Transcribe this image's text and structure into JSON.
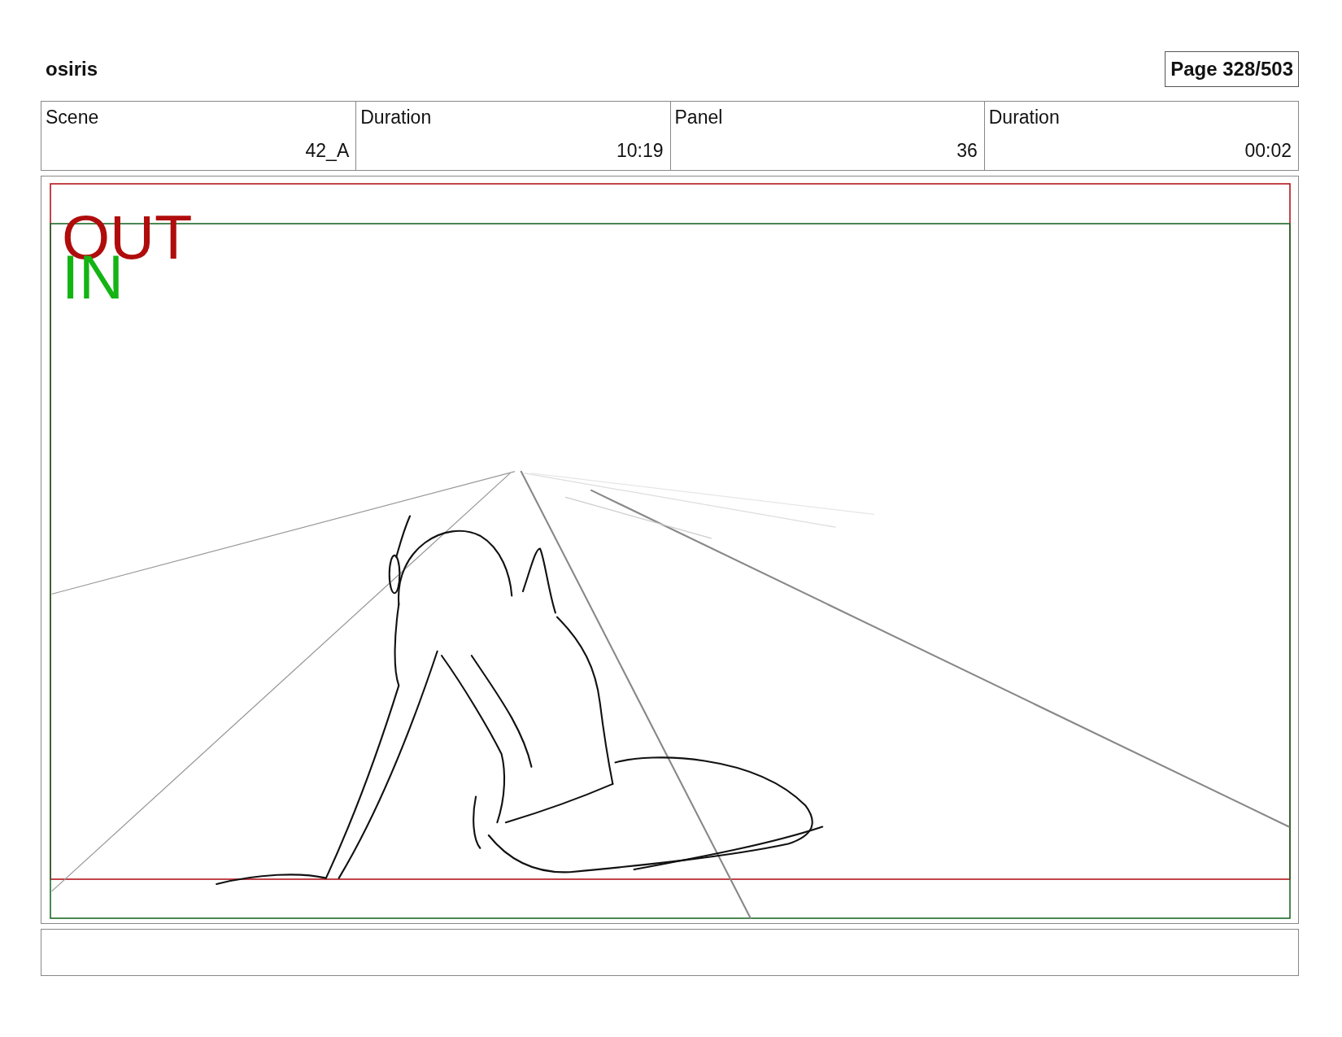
{
  "project_title": "osiris",
  "page_indicator": "Page 328/503",
  "header_table": {
    "columns": [
      {
        "heading": "Scene",
        "cell": "42_A"
      },
      {
        "heading": "Duration",
        "cell": "10:19"
      },
      {
        "heading": "Panel",
        "cell": "36"
      },
      {
        "heading": "Duration",
        "cell": "00:02"
      }
    ]
  },
  "panel": {
    "frame_labels": [
      {
        "kind": "out",
        "text": "OUT"
      },
      {
        "kind": "in",
        "text": "IN"
      }
    ]
  }
}
